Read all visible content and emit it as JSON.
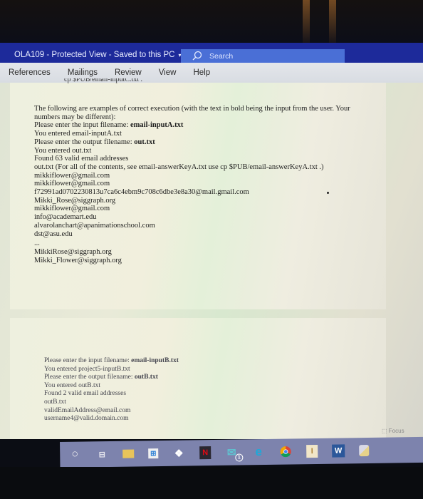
{
  "window": {
    "title": "OLA109  -  Protected View  -  Saved to this PC",
    "title_caret": "▾",
    "search_placeholder": "Search"
  },
  "ribbon": {
    "tabs": [
      {
        "label": "References"
      },
      {
        "label": "Mailings"
      },
      {
        "label": "Review"
      },
      {
        "label": "View"
      },
      {
        "label": "Help"
      }
    ]
  },
  "document": {
    "cutoff_line": "cp $PUB/email-inputC.txt .",
    "intro_line1": "The following are examples of correct execution (with the text in bold being the input from the user. Your",
    "intro_line2": "numbers may be different):",
    "example_a": {
      "prompt_input": "Please enter the input filename: ",
      "input_value": "email-inputA.txt",
      "entered_input": "You entered email-inputA.txt",
      "prompt_output": "Please enter the output filename: ",
      "output_value": "out.txt",
      "entered_output": "You entered out.txt",
      "found": "Found 63 valid email addresses",
      "file_note": "out.txt (For all of the contents, see email-answerKeyA.txt  use cp $PUB/email-answerKeyA.txt .)",
      "emails": [
        "mikkiflower@gmail.com",
        "mikkiflower@gmail.com",
        "f72991ad0702230813u7ca6c4ebm9c708c6dbe3e8a30@mail.gmail.com",
        "Mikki_Rose@siggraph.org",
        "mikkiflower@gmail.com",
        "info@academart.edu",
        "alvarolanchart@apanimationschool.com",
        "dst@asu.edu"
      ],
      "ellipsis": "...",
      "tail_emails": [
        "MikkiRose@siggraph.org",
        "Mikki_Flower@siggraph.org"
      ]
    },
    "example_b": {
      "prompt_input": "Please enter the input filename: ",
      "input_value": "email-inputB.txt",
      "entered_input": "You entered project5-inputB.txt",
      "prompt_output": "Please enter the output filename: ",
      "output_value": "outB.txt",
      "entered_output": "You entered outB.txt",
      "found": "Found 2 valid email addresses",
      "file_name": "outB.txt",
      "emails": [
        "validEmailAddress@email.com",
        "username4@valid.domain.com"
      ]
    }
  },
  "statusbar": {
    "focus_label": "Focus"
  },
  "taskbar": {
    "icons": [
      {
        "name": "cortana-search-icon",
        "glyph": "○"
      },
      {
        "name": "task-view-icon",
        "glyph": "⊟"
      },
      {
        "name": "file-explorer-icon",
        "glyph": "▀"
      },
      {
        "name": "microsoft-store-icon",
        "glyph": "⊞"
      },
      {
        "name": "dropbox-icon",
        "glyph": "❖"
      },
      {
        "name": "netflix-icon",
        "glyph": "N"
      },
      {
        "name": "mail-icon",
        "glyph": "✉",
        "badge": "1"
      },
      {
        "name": "edge-icon",
        "glyph": "e"
      },
      {
        "name": "chrome-icon",
        "glyph": "◉"
      },
      {
        "name": "sticky-app-icon",
        "glyph": "I"
      },
      {
        "name": "word-icon",
        "glyph": "W"
      },
      {
        "name": "python-icon",
        "glyph": "⚲"
      }
    ]
  }
}
